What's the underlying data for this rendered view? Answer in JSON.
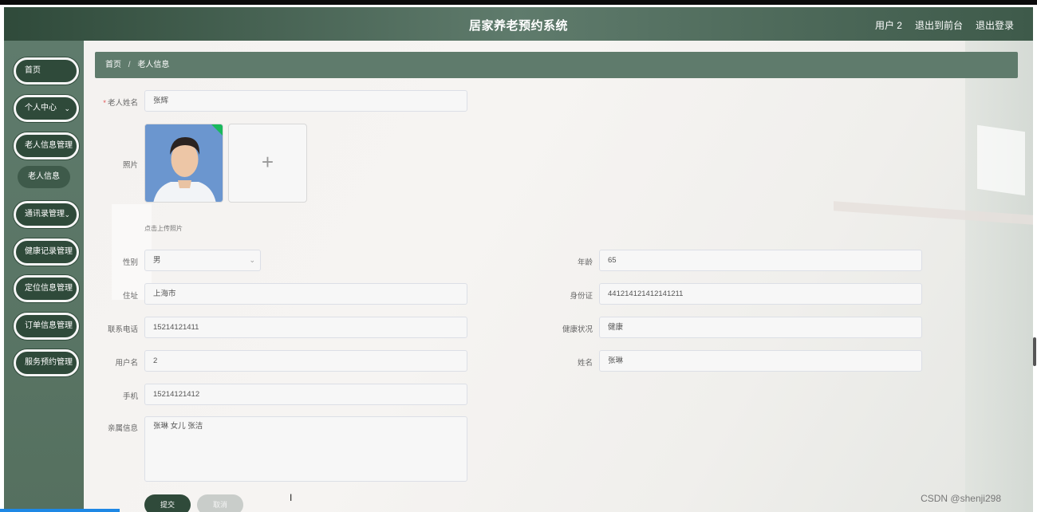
{
  "header": {
    "title": "居家养老预约系统",
    "user": "用户 2",
    "back_front": "退出到前台",
    "logout": "退出登录"
  },
  "sidebar": {
    "items": [
      {
        "label": "首页",
        "has_arrow": false
      },
      {
        "label": "个人中心",
        "has_arrow": true
      },
      {
        "label": "老人信息管理",
        "has_arrow": true
      },
      {
        "label": "通讯录管理",
        "has_arrow": true
      },
      {
        "label": "健康记录管理",
        "has_arrow": true
      },
      {
        "label": "定位信息管理",
        "has_arrow": true
      },
      {
        "label": "订单信息管理",
        "has_arrow": true
      },
      {
        "label": "服务预约管理",
        "has_arrow": true
      }
    ],
    "sub_item": "老人信息"
  },
  "breadcrumb": {
    "home": "首页",
    "sep": "/",
    "current": "老人信息"
  },
  "form": {
    "name": {
      "label": "老人姓名",
      "value": "张辉"
    },
    "photo": {
      "label": "照片",
      "hint": "点击上传照片"
    },
    "gender": {
      "label": "性别",
      "value": "男"
    },
    "age": {
      "label": "年龄",
      "value": "65"
    },
    "address": {
      "label": "住址",
      "value": "上海市"
    },
    "id_card": {
      "label": "身份证",
      "value": "441214121412141211"
    },
    "phone": {
      "label": "联系电话",
      "value": "15214121411"
    },
    "health": {
      "label": "健康状况",
      "value": "健康"
    },
    "username": {
      "label": "用户名",
      "value": "2"
    },
    "real_name": {
      "label": "姓名",
      "value": "张琳"
    },
    "mobile": {
      "label": "手机",
      "value": "15214121412"
    },
    "family": {
      "label": "亲属信息",
      "value": "张琳 女儿 张洁"
    }
  },
  "buttons": {
    "submit": "提交",
    "cancel": "取消"
  },
  "watermark": "CSDN @shenji298",
  "colors": {
    "primary": "#2f4a3a",
    "secondary": "#5f7b6c"
  }
}
